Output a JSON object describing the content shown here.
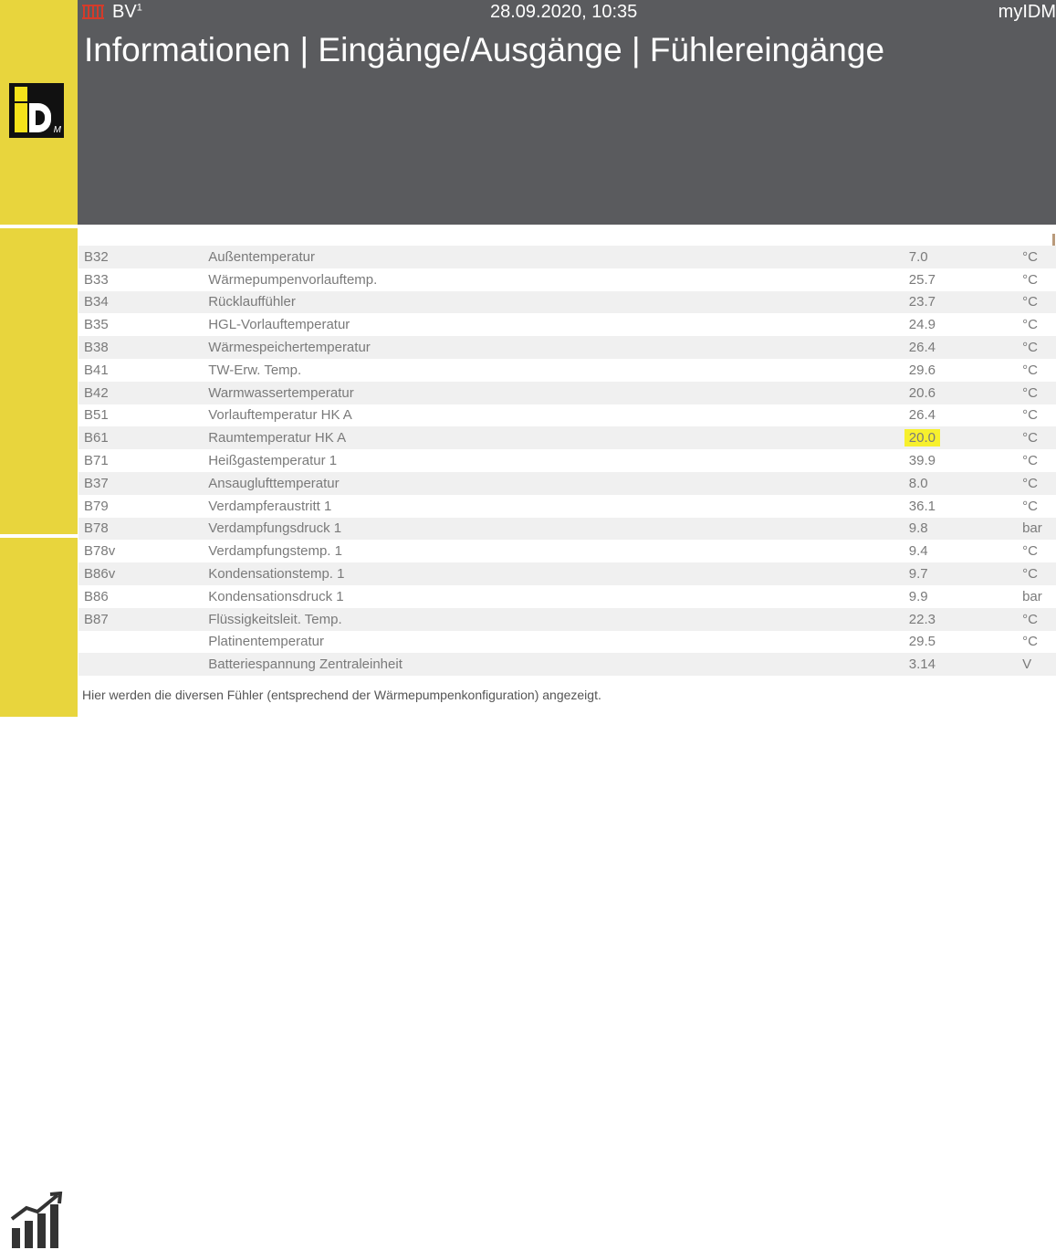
{
  "header": {
    "system_name": "BV",
    "system_superscript": "1",
    "datetime": "28.09.2020, 10:35",
    "user": "myIDM",
    "title": "Informationen | Eingänge/Ausgänge | Fühlereingänge"
  },
  "sidebar": {
    "logo_icon": "idm-logo-icon",
    "io_icon": "inputs-outputs-icon",
    "stats_icon": "statistics-chart-icon",
    "accent_color": "#e8d53d"
  },
  "sensors": [
    {
      "code": "B32",
      "name": "Außentemperatur",
      "value": "7.0",
      "unit": "°C",
      "highlighted": false
    },
    {
      "code": "B33",
      "name": "Wärmepumpenvorlauftemp.",
      "value": "25.7",
      "unit": "°C",
      "highlighted": false
    },
    {
      "code": "B34",
      "name": "Rücklauffühler",
      "value": "23.7",
      "unit": "°C",
      "highlighted": false
    },
    {
      "code": "B35",
      "name": "HGL-Vorlauftemperatur",
      "value": "24.9",
      "unit": "°C",
      "highlighted": false
    },
    {
      "code": "B38",
      "name": "Wärmespeichertemperatur",
      "value": "26.4",
      "unit": "°C",
      "highlighted": false
    },
    {
      "code": "B41",
      "name": "TW-Erw. Temp.",
      "value": "29.6",
      "unit": "°C",
      "highlighted": false
    },
    {
      "code": "B42",
      "name": "Warmwassertemperatur",
      "value": "20.6",
      "unit": "°C",
      "highlighted": false
    },
    {
      "code": "B51",
      "name": "Vorlauftemperatur HK A",
      "value": "26.4",
      "unit": "°C",
      "highlighted": false
    },
    {
      "code": "B61",
      "name": "Raumtemperatur HK A",
      "value": "20.0",
      "unit": "°C",
      "highlighted": true
    },
    {
      "code": "B71",
      "name": "Heißgastemperatur 1",
      "value": "39.9",
      "unit": "°C",
      "highlighted": false
    },
    {
      "code": "B37",
      "name": "Ansauglufttemperatur",
      "value": "8.0",
      "unit": "°C",
      "highlighted": false
    },
    {
      "code": "B79",
      "name": "Verdampferaustritt 1",
      "value": "36.1",
      "unit": "°C",
      "highlighted": false
    },
    {
      "code": "B78",
      "name": "Verdampfungsdruck 1",
      "value": "9.8",
      "unit": "bar",
      "highlighted": false
    },
    {
      "code": "B78v",
      "name": "Verdampfungstemp. 1",
      "value": "9.4",
      "unit": "°C",
      "highlighted": false
    },
    {
      "code": "B86v",
      "name": "Kondensationstemp. 1",
      "value": "9.7",
      "unit": "°C",
      "highlighted": false
    },
    {
      "code": "B86",
      "name": "Kondensationsdruck 1",
      "value": "9.9",
      "unit": "bar",
      "highlighted": false
    },
    {
      "code": "B87",
      "name": "Flüssigkeitsleit. Temp.",
      "value": "22.3",
      "unit": "°C",
      "highlighted": false
    },
    {
      "code": "",
      "name": "Platinentemperatur",
      "value": "29.5",
      "unit": "°C",
      "highlighted": false
    },
    {
      "code": "",
      "name": "Batteriespannung Zentraleinheit",
      "value": "3.14",
      "unit": "V",
      "highlighted": false
    }
  ],
  "footer_note": "Hier werden die diversen Fühler (entsprechend der Wärmepumpenkonfiguration) angezeigt."
}
